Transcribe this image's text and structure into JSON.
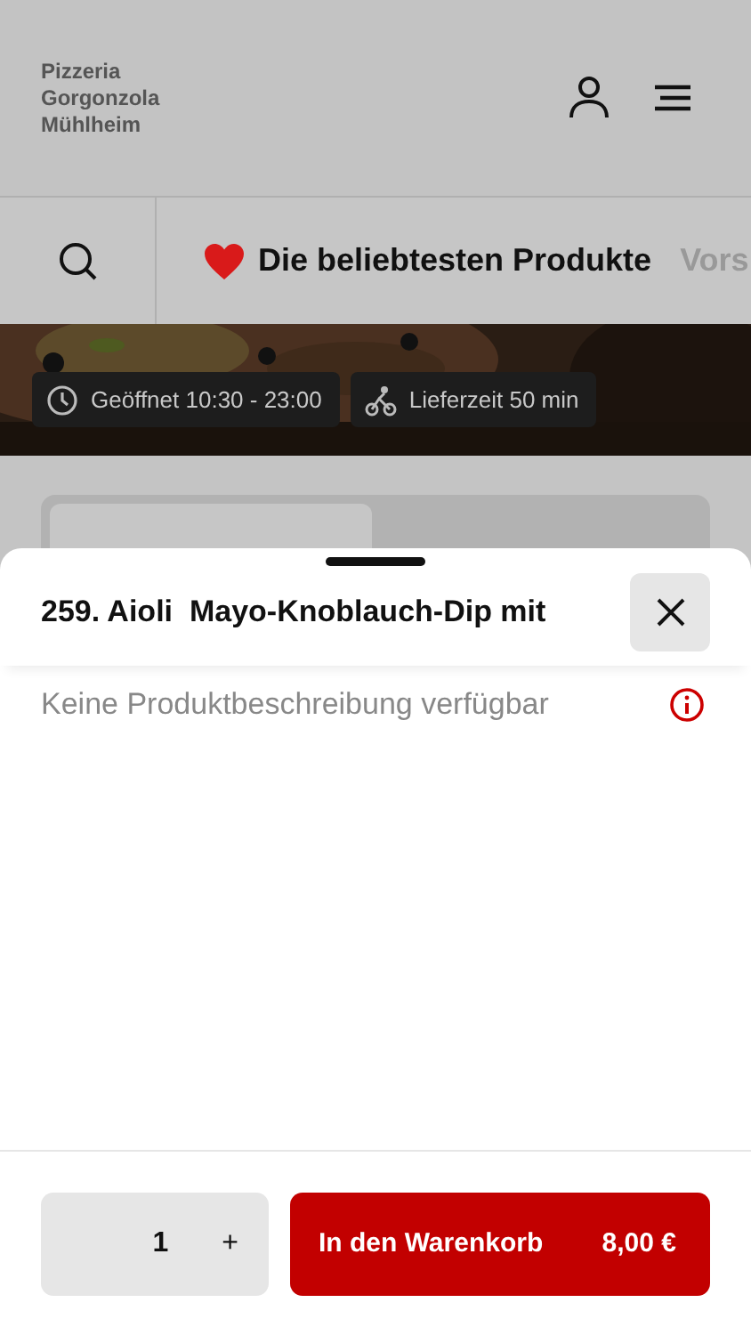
{
  "header": {
    "restaurant_name": "Pizzeria Gorgonzola Mühlheim"
  },
  "category_bar": {
    "categories": [
      {
        "label": "Die beliebtesten Produkte",
        "selected": true,
        "kind": "heart"
      },
      {
        "label": "Vors",
        "selected": false
      }
    ]
  },
  "banner": {
    "kind": "picture",
    "chips": [
      {
        "kind": "clock",
        "text": "Geöffnet 10:30 - 23:00"
      },
      {
        "kind": "bike",
        "text": "Lieferzeit 50 min"
      }
    ]
  },
  "order_mode_tabs": [
    {
      "selected": true
    },
    {
      "selected": false
    }
  ],
  "product_sheet": {
    "title": "259. Aioli  Mayo-Knoblauch-Dip mit",
    "description": "Keine Produktbeschreibung verfügbar",
    "quantity": "1",
    "plus": "+",
    "add_button": "In den Warenkorb",
    "price": "8,00 €"
  }
}
